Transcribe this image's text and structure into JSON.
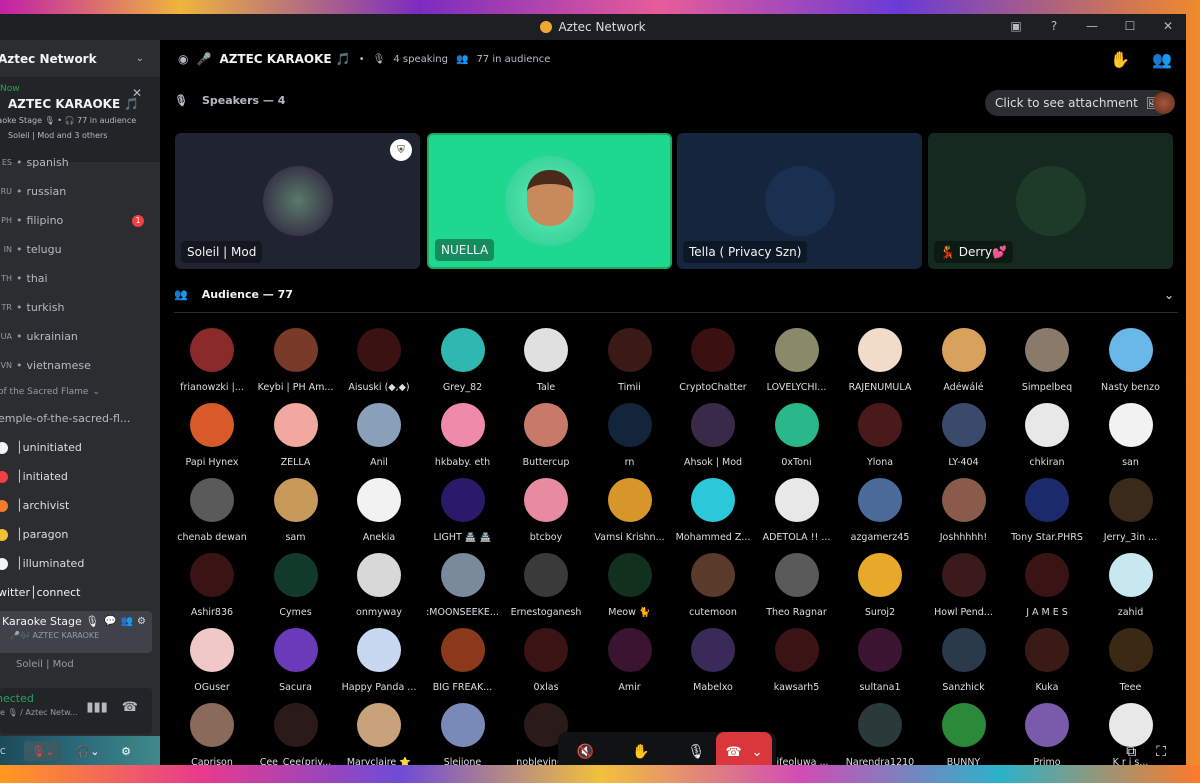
{
  "window": {
    "title": "Aztec Network",
    "controls": [
      "inbox-icon",
      "help-icon",
      "minimize-icon",
      "maximize-icon",
      "close-icon"
    ]
  },
  "sidebar": {
    "server_name": "Aztec Network",
    "now_card": {
      "label": "Now",
      "title": "AZTEC KARAOKE 🎵",
      "sub": "raoke Stage 🎙 • 🎧 77 in audience",
      "people": "Soleil | Mod and 3 others"
    },
    "channels": [
      {
        "prefix": "ES",
        "name": "spanish",
        "badge": ""
      },
      {
        "prefix": "RU",
        "name": "russian",
        "badge": ""
      },
      {
        "prefix": "PH",
        "name": "filipino",
        "badge": "1"
      },
      {
        "prefix": "IN",
        "name": "telugu",
        "badge": ""
      },
      {
        "prefix": "TH",
        "name": "thai",
        "badge": ""
      },
      {
        "prefix": "TR",
        "name": "turkish",
        "badge": ""
      },
      {
        "prefix": "UA",
        "name": "ukrainian",
        "badge": ""
      },
      {
        "prefix": "VN",
        "name": "vietnamese",
        "badge": ""
      }
    ],
    "category": "of the Sacred Flame",
    "temple_channel": "emple-of-the-sacred-fl...",
    "role_channels": [
      {
        "name": "uninitiated",
        "color": "#f2f3f5"
      },
      {
        "name": "initiated",
        "color": "#f23f43"
      },
      {
        "name": "archivist",
        "color": "#f47b2a"
      },
      {
        "name": "paragon",
        "color": "#f0c132"
      },
      {
        "name": "illuminated",
        "color": "#f2f3f5"
      }
    ],
    "twitter_channel": "witter│connect",
    "karaoke_channel": {
      "name": "Karaoke Stage 🎙",
      "sub": "🎤🎶 AZTEC KARAOKE"
    },
    "voice_user": "Soleil | Mod",
    "rtc": {
      "status": "nected",
      "channel": "e 🎙 / Aztec Netw..."
    },
    "user_cc": "C"
  },
  "stage": {
    "title": "AZTEC KARAOKE 🎵",
    "speaking": "4 speaking",
    "audience": "77 in audience",
    "speakers_label": "Speakers — 4",
    "attachment": "Click to see attachment",
    "speakers": [
      {
        "name": "Soleil | Mod",
        "bg": "#1f2430"
      },
      {
        "name": "NUELLA",
        "bg": "#1fd88f"
      },
      {
        "name": "Tella ( Privacy Szn)",
        "bg": "#14253d"
      },
      {
        "name": "💃 Derry💕",
        "bg": "#15291f"
      }
    ],
    "audience_label": "Audience — 77"
  },
  "audience": [
    {
      "name": "frianowzki |...",
      "c": "#8a2a2a"
    },
    {
      "name": "Keybi | PH Am...",
      "c": "#7a3a2a"
    },
    {
      "name": "Aisuski (◆,◆)",
      "c": "#3a1212"
    },
    {
      "name": "Grey_82",
      "c": "#2fb8b0"
    },
    {
      "name": "Tale",
      "c": "#e0e0e0"
    },
    {
      "name": "Timii",
      "c": "#3a1a14"
    },
    {
      "name": "CryptoChatter",
      "c": "#3a1010"
    },
    {
      "name": "LOVELYCHI...",
      "c": "#8a8a6a"
    },
    {
      "name": "RAJENUMULA",
      "c": "#f0dcc8"
    },
    {
      "name": "Adéwálé",
      "c": "#d8a25c"
    },
    {
      "name": "Simpelbeq",
      "c": "#8a7a6a"
    },
    {
      "name": "Nasty benzo",
      "c": "#6ab8e8"
    },
    {
      "name": "Papi Hynex",
      "c": "#d85a2a"
    },
    {
      "name": "ZELLA",
      "c": "#f0a8a0"
    },
    {
      "name": "Anil",
      "c": "#8aa0b8"
    },
    {
      "name": "hkbaby. eth",
      "c": "#f08aaa"
    },
    {
      "name": "Buttercup",
      "c": "#c87a6a"
    },
    {
      "name": "rn",
      "c": "#12253a"
    },
    {
      "name": "Ahsok | Mod",
      "c": "#3a2a4a"
    },
    {
      "name": "0xToni",
      "c": "#2ab88a"
    },
    {
      "name": "Ylona",
      "c": "#4a1a1a"
    },
    {
      "name": "LY-404",
      "c": "#3a4a6a"
    },
    {
      "name": "chkiran",
      "c": "#e8e8e8"
    },
    {
      "name": "san",
      "c": "#f2f2f2"
    },
    {
      "name": "chenab dewan",
      "c": "#5a5a5a"
    },
    {
      "name": "sam",
      "c": "#c89a5a"
    },
    {
      "name": "Anekia",
      "c": "#f2f2f2"
    },
    {
      "name": "LIGHT 🏯 🏯",
      "c": "#2a1a6a"
    },
    {
      "name": "btcboy",
      "c": "#e88aa0"
    },
    {
      "name": "Vamsi Krishn...",
      "c": "#d8962a"
    },
    {
      "name": "Mohammed Z...",
      "c": "#2ac8d8"
    },
    {
      "name": "ADETOLA !! ...",
      "c": "#e8e8e8"
    },
    {
      "name": "azgamerz45",
      "c": "#4a6a9a"
    },
    {
      "name": "Joshhhhh!",
      "c": "#8a5a4a"
    },
    {
      "name": "Tony Star.PHRS",
      "c": "#1a2a6a"
    },
    {
      "name": "Jerry_3in ...",
      "c": "#3a2a1a"
    },
    {
      "name": "Ashir836",
      "c": "#3a1414"
    },
    {
      "name": "Cymes",
      "c": "#123a2a"
    },
    {
      "name": "onmyway",
      "c": "#d8d8d8"
    },
    {
      "name": ":MOONSEEKE...",
      "c": "#7a8a9a"
    },
    {
      "name": "Ernestoganesh",
      "c": "#3a3a3a"
    },
    {
      "name": "Meow 🐈",
      "c": "#12301e"
    },
    {
      "name": "cutemoon",
      "c": "#5a3a2a"
    },
    {
      "name": "Theo Ragnar",
      "c": "#5a5a5a"
    },
    {
      "name": "Suroj2",
      "c": "#e8a82a"
    },
    {
      "name": "Howl Pend...",
      "c": "#3a1a1a"
    },
    {
      "name": "J A M E S",
      "c": "#3a1414"
    },
    {
      "name": "zahid",
      "c": "#c8e8f0"
    },
    {
      "name": "OGuser",
      "c": "#f0c8c8"
    },
    {
      "name": "Sacura",
      "c": "#6a3ab8"
    },
    {
      "name": "Happy Panda ...",
      "c": "#c8d8f0"
    },
    {
      "name": "BIG FREAK...",
      "c": "#8a3a1a"
    },
    {
      "name": "0xlas",
      "c": "#3a1414"
    },
    {
      "name": "Amir",
      "c": "#3a1430"
    },
    {
      "name": "Mabelxo",
      "c": "#3a2a5a"
    },
    {
      "name": "kawsarh5",
      "c": "#3a1414"
    },
    {
      "name": "sultana1",
      "c": "#3a1430"
    },
    {
      "name": "Sanzhick",
      "c": "#2a3a4a"
    },
    {
      "name": "Kuka",
      "c": "#3a1a14"
    },
    {
      "name": "Teee",
      "c": "#3a2a14"
    },
    {
      "name": "Caprison",
      "c": "#8a6a5a"
    },
    {
      "name": "Cee_Cee(priv...",
      "c": "#2a1a1a"
    },
    {
      "name": "Maryclaire ⭐",
      "c": "#c8a27a"
    },
    {
      "name": "Sleijone",
      "c": "#7a8ab8"
    },
    {
      "name": "noblevin(E...",
      "c": "#2a1a1a"
    },
    {
      "name": "",
      "c": "#000000"
    },
    {
      "name": "",
      "c": "#000000"
    },
    {
      "name": "hnifeoluwa ...",
      "c": "#000000"
    },
    {
      "name": "Narendra1210",
      "c": "#2a3a3a"
    },
    {
      "name": "BUNNY",
      "c": "#2a8a3a"
    },
    {
      "name": "Primo",
      "c": "#7a5aaa"
    },
    {
      "name": "K r i s...",
      "c": "#e8e8e8"
    }
  ],
  "controls": {
    "buttons": [
      "mute-speaker-icon",
      "raise-hand-icon",
      "request-speak-icon",
      "more-icon"
    ],
    "leave": "leave-call-icon"
  },
  "colors": {
    "accent": "#23a55a",
    "danger": "#da373c",
    "highlight": "#1fd88f"
  }
}
